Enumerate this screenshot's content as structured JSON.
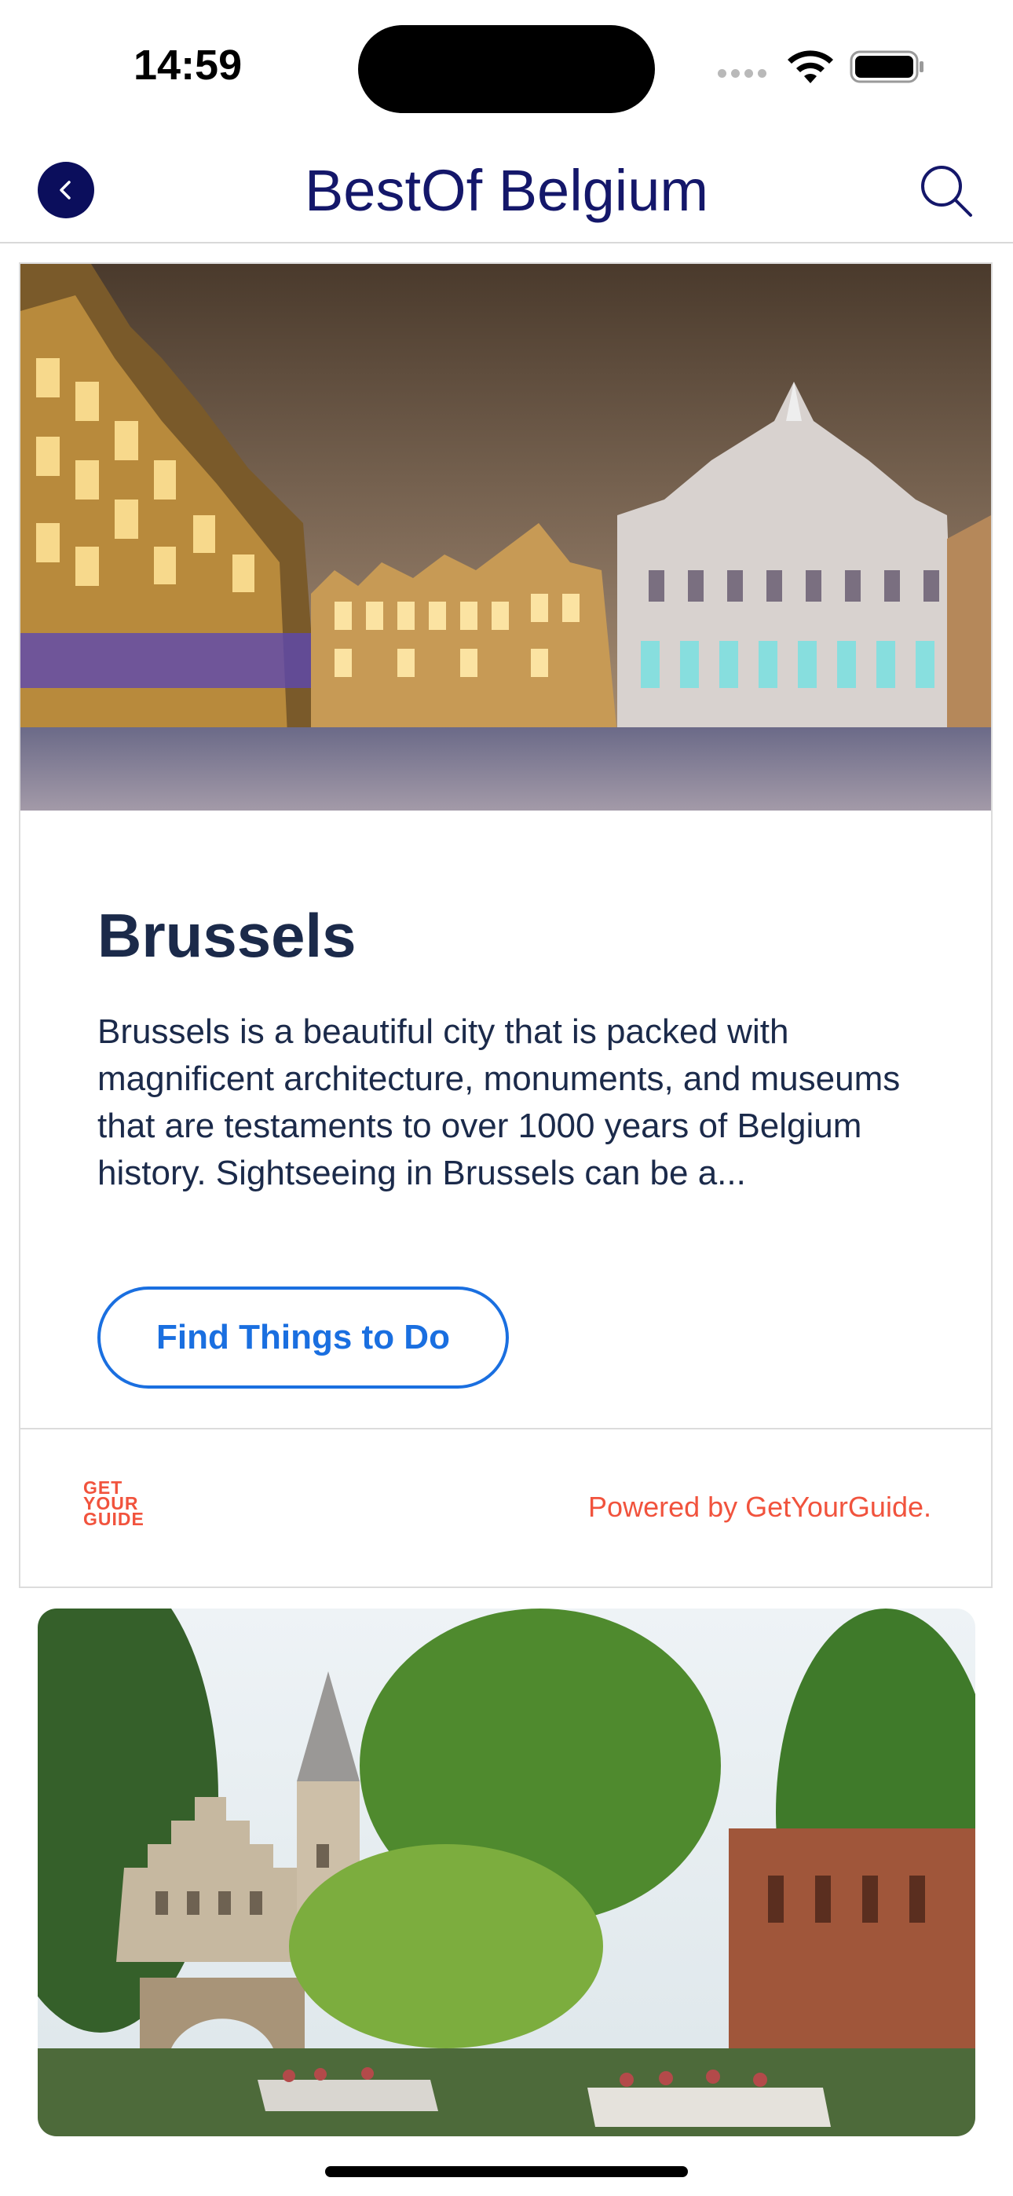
{
  "status_bar": {
    "time": "14:59"
  },
  "nav": {
    "title": "BestOf Belgium",
    "back_icon": "chevron-left-icon",
    "search_icon": "search-icon"
  },
  "card": {
    "image": "brussels-grand-place-night-photo",
    "title": "Brussels",
    "description": "Brussels is a beautiful city that is packed with magnificent architecture, monuments, and museums that are testaments to over 1000 years of Belgium history. Sightseeing in Brussels can be a...",
    "cta_label": "Find Things to Do",
    "logo_lines": [
      "GET",
      "YOUR",
      "GUIDE"
    ],
    "powered_by": "Powered by GetYourGuide."
  },
  "next_card": {
    "image": "canal-boats-castle-photo"
  },
  "colors": {
    "nav_title": "#14176a",
    "back_button_bg": "#0b0e5c",
    "card_text": "#1b2a4a",
    "cta_blue": "#1a6fe0",
    "gyg_orange": "#f1533d"
  }
}
